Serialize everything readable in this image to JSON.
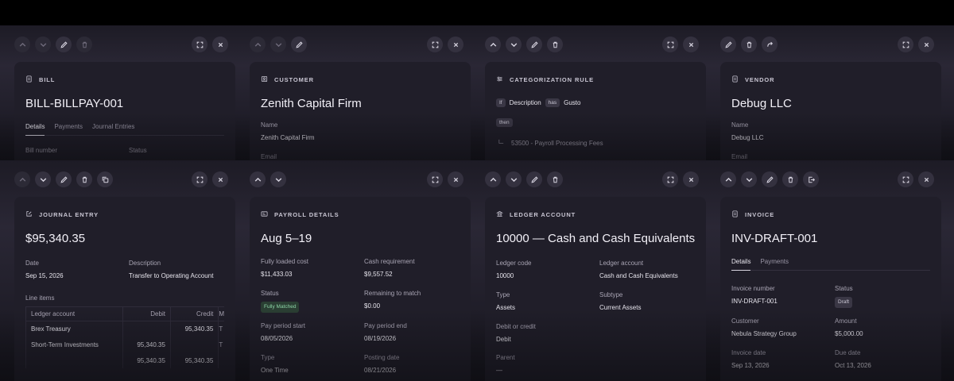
{
  "panels": {
    "bill": {
      "type_label": "BILL",
      "title": "BILL-BILLPAY-001",
      "tabs": [
        "Details",
        "Payments",
        "Journal Entries"
      ],
      "fields": [
        {
          "label": "Bill number"
        },
        {
          "label": "Status"
        }
      ]
    },
    "customer": {
      "type_label": "CUSTOMER",
      "title": "Zenith Capital Firm",
      "name_label": "Name",
      "name_value": "Zenith Capital Firm",
      "email_label": "Email"
    },
    "rule": {
      "type_label": "CATEGORIZATION RULE",
      "field_chip": "If",
      "field": "Description",
      "operator": "has",
      "value": "Gusto",
      "then": "then",
      "target": "53500 - Payroll Processing Fees"
    },
    "vendor": {
      "type_label": "VENDOR",
      "title": "Debug LLC",
      "name_label": "Name",
      "name_value": "Debug LLC",
      "email_label": "Email"
    },
    "journal": {
      "type_label": "JOURNAL ENTRY",
      "title": "$95,340.35",
      "date_label": "Date",
      "date_value": "Sep 15, 2026",
      "desc_label": "Description",
      "desc_value": "Transfer to Operating Account",
      "line_items_label": "Line items",
      "columns": [
        "Ledger account",
        "Debit",
        "Credit",
        "M"
      ],
      "rows": [
        [
          "Brex Treasury",
          "",
          "95,340.35",
          "T"
        ],
        [
          "Short-Term Investments",
          "95,340.35",
          "",
          "T"
        ],
        [
          "",
          "95,340.35",
          "95,340.35",
          ""
        ]
      ]
    },
    "payroll": {
      "type_label": "PAYROLL DETAILS",
      "title": "Aug 5–19",
      "fields": [
        {
          "label": "Fully loaded cost",
          "value": "$11,433.03"
        },
        {
          "label": "Cash requirement",
          "value": "$9,557.52"
        },
        {
          "label": "Status",
          "badge": "Fully Matched"
        },
        {
          "label": "Remaining to match",
          "value": "$0.00"
        },
        {
          "label": "Pay period start",
          "value": "08/05/2026"
        },
        {
          "label": "Pay period end",
          "value": "08/19/2026"
        },
        {
          "label": "Type",
          "value": "One Time"
        },
        {
          "label": "Posting date",
          "value": "08/21/2026"
        }
      ]
    },
    "ledger": {
      "type_label": "LEDGER ACCOUNT",
      "title": "10000 — Cash and Cash Equivalents",
      "fields": [
        {
          "label": "Ledger code",
          "value": "10000"
        },
        {
          "label": "Ledger account",
          "value": "Cash and Cash Equivalents"
        },
        {
          "label": "Type",
          "value": "Assets"
        },
        {
          "label": "Subtype",
          "value": "Current Assets"
        },
        {
          "label": "Debit or credit",
          "value": "Debit"
        },
        {
          "label": "",
          "value": ""
        },
        {
          "label": "Parent",
          "value": "—"
        }
      ]
    },
    "invoice": {
      "type_label": "INVOICE",
      "title": "INV-DRAFT-001",
      "tabs": [
        "Details",
        "Payments"
      ],
      "fields": [
        {
          "label": "Invoice number",
          "value": "INV-DRAFT-001"
        },
        {
          "label": "Status",
          "badge": "Draft"
        },
        {
          "label": "Customer",
          "value": "Nebula Strategy Group"
        },
        {
          "label": "Amount",
          "value": "$5,000.00"
        },
        {
          "label": "Invoice date",
          "value": "Sep 13, 2026"
        },
        {
          "label": "Due date",
          "value": "Oct 13, 2026"
        }
      ]
    }
  },
  "icons": {
    "up": "chevron-up-icon",
    "down": "chevron-down-icon",
    "edit": "pencil-icon",
    "delete": "trash-icon",
    "duplicate": "copy-icon",
    "expand": "expand-icon",
    "close": "close-icon",
    "share": "redo-icon",
    "export": "export-icon"
  }
}
